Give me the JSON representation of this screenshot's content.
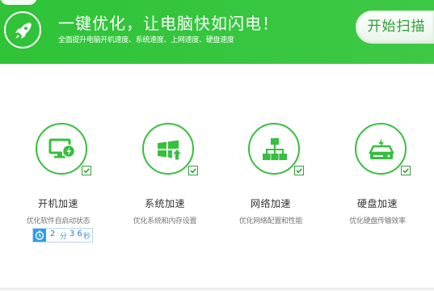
{
  "header": {
    "title": "一键优化，让电脑快如闪电！",
    "subtitle": "全面提升电脑开机速度、系统速度、上网速度、硬盘速度",
    "start_button": "开始扫描",
    "logo_icon": "rocket-icon"
  },
  "features": [
    {
      "title": "开机加速",
      "desc": "优化软件自启动状态",
      "icon": "monitor-boost-icon",
      "checked": true
    },
    {
      "title": "系统加速",
      "desc": "优化系统和内存设置",
      "icon": "windows-boost-icon",
      "checked": true
    },
    {
      "title": "网络加速",
      "desc": "优化网络配置和性能",
      "icon": "network-icon",
      "checked": true
    },
    {
      "title": "硬盘加速",
      "desc": "优化硬盘传输效率",
      "icon": "hard-drive-icon",
      "checked": true
    }
  ],
  "timer": {
    "icon": "clock-icon",
    "minutes": "2",
    "minutes_unit": "分",
    "seconds": "36",
    "seconds_unit": "秒"
  },
  "colors": {
    "brand_green": "#36c63f",
    "icon_green": "#37bf3e",
    "timer_blue": "#2d9ee9"
  }
}
